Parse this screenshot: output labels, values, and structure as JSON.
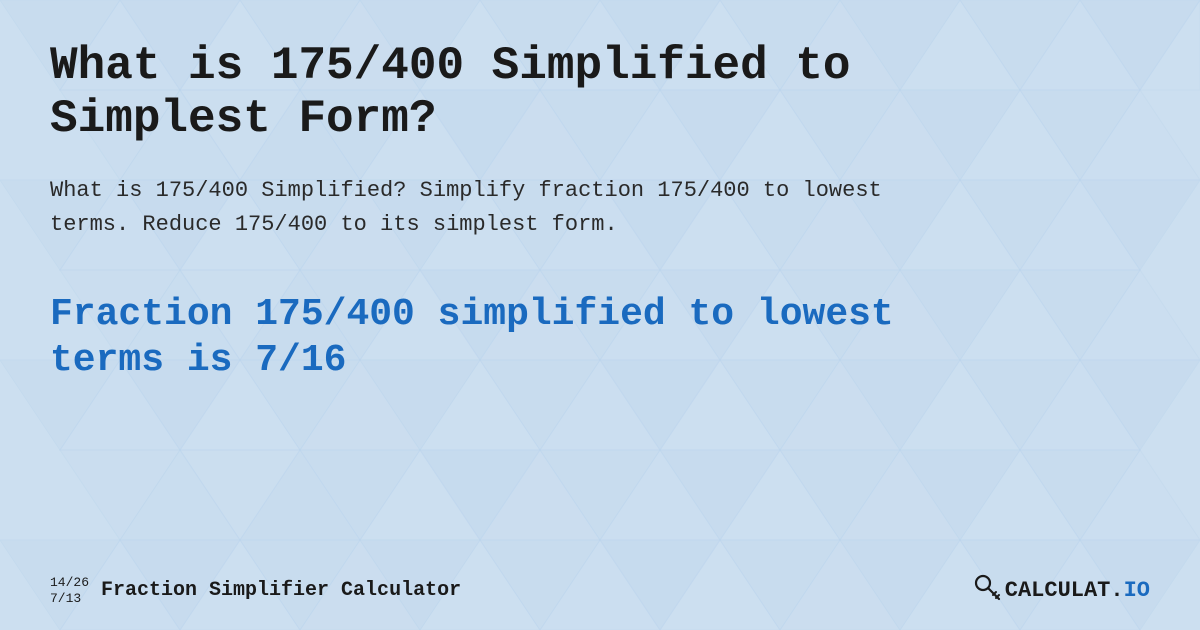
{
  "background": {
    "base_color": "#cce0f5",
    "pattern_color_light": "#d8eaf7",
    "pattern_color_mid": "#bfd5ed"
  },
  "header": {
    "title": "What is 175/400 Simplified to Simplest Form?"
  },
  "description": {
    "text": "What is 175/400 Simplified? Simplify fraction 175/400 to lowest terms. Reduce 175/400 to its simplest form."
  },
  "result": {
    "text": "Fraction 175/400 simplified to lowest terms is 7/16"
  },
  "footer": {
    "fraction_top": "14/26",
    "fraction_bottom": "7/13",
    "brand": "Fraction Simplifier Calculator",
    "logo_text": "CALCULAT.IO",
    "logo_pre": "CALCULAT.",
    "logo_suffix": "IO"
  }
}
